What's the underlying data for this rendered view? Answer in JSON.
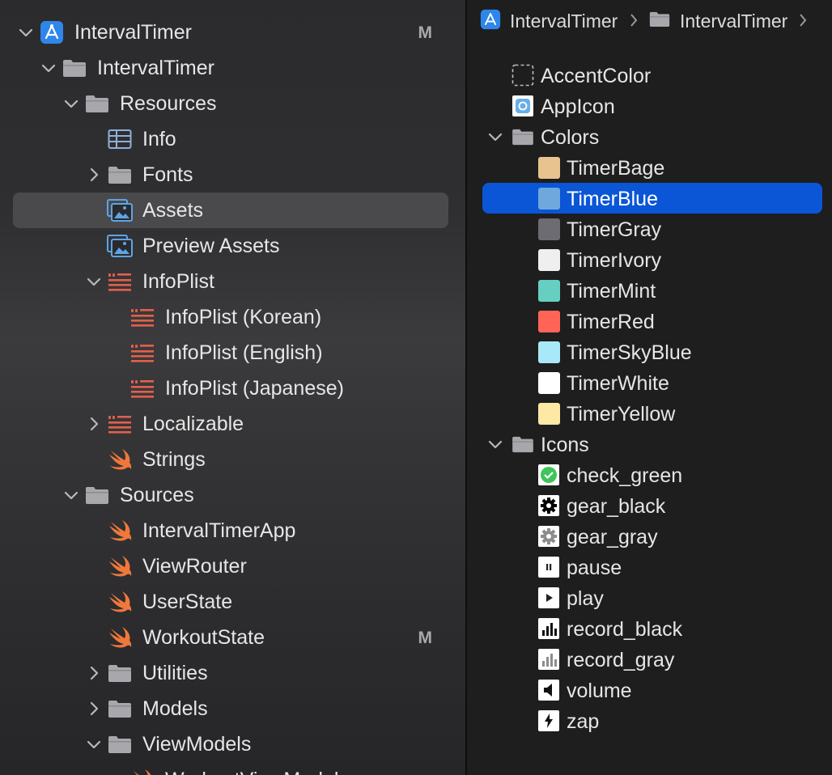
{
  "navigator": {
    "rows": [
      {
        "label": "IntervalTimer",
        "icon": "xcode-project-icon",
        "badge": "M",
        "chevron": "down"
      },
      {
        "label": "IntervalTimer",
        "icon": "folder-icon",
        "chevron": "down"
      },
      {
        "label": "Resources",
        "icon": "folder-icon",
        "chevron": "down"
      },
      {
        "label": "Info",
        "icon": "table-icon"
      },
      {
        "label": "Fonts",
        "icon": "folder-icon",
        "chevron": "right"
      },
      {
        "label": "Assets",
        "icon": "asset-catalog-icon",
        "selected": true
      },
      {
        "label": "Preview Assets",
        "icon": "asset-catalog-icon"
      },
      {
        "label": "InfoPlist",
        "icon": "strings-icon",
        "chevron": "down"
      },
      {
        "label": "InfoPlist (Korean)",
        "icon": "strings-icon"
      },
      {
        "label": "InfoPlist (English)",
        "icon": "strings-icon"
      },
      {
        "label": "InfoPlist (Japanese)",
        "icon": "strings-icon"
      },
      {
        "label": "Localizable",
        "icon": "strings-icon",
        "chevron": "right"
      },
      {
        "label": "Strings",
        "icon": "swift-icon"
      },
      {
        "label": "Sources",
        "icon": "folder-icon",
        "chevron": "down"
      },
      {
        "label": "IntervalTimerApp",
        "icon": "swift-icon"
      },
      {
        "label": "ViewRouter",
        "icon": "swift-icon"
      },
      {
        "label": "UserState",
        "icon": "swift-icon"
      },
      {
        "label": "WorkoutState",
        "icon": "swift-icon",
        "badge": "M"
      },
      {
        "label": "Utilities",
        "icon": "folder-icon",
        "chevron": "right"
      },
      {
        "label": "Models",
        "icon": "folder-icon",
        "chevron": "right"
      },
      {
        "label": "ViewModels",
        "icon": "folder-icon",
        "chevron": "down"
      },
      {
        "label": "WorkoutViewModel",
        "icon": "swift-icon"
      }
    ]
  },
  "jump_bar": {
    "items": [
      "IntervalTimer",
      "IntervalTimer"
    ]
  },
  "assets": {
    "rows": [
      {
        "label": "AccentColor",
        "icon": "accent-color-icon"
      },
      {
        "label": "AppIcon",
        "icon": "app-icon-icon"
      },
      {
        "label": "Colors",
        "icon": "folder-icon",
        "chevron": "down"
      },
      {
        "label": "TimerBage",
        "icon": "color-swatch",
        "color": "#e8c38f"
      },
      {
        "label": "TimerBlue",
        "icon": "color-swatch",
        "color": "#6fa8dc",
        "selected": true
      },
      {
        "label": "TimerGray",
        "icon": "color-swatch",
        "color": "#6d6c73"
      },
      {
        "label": "TimerIvory",
        "icon": "color-swatch",
        "color": "#efefef"
      },
      {
        "label": "TimerMint",
        "icon": "color-swatch",
        "color": "#66cfc2"
      },
      {
        "label": "TimerRed",
        "icon": "color-swatch",
        "color": "#ff6457"
      },
      {
        "label": "TimerSkyBlue",
        "icon": "color-swatch",
        "color": "#a8e8f8"
      },
      {
        "label": "TimerWhite",
        "icon": "color-swatch",
        "color": "#ffffff"
      },
      {
        "label": "TimerYellow",
        "icon": "color-swatch",
        "color": "#fde9a4"
      },
      {
        "label": "Icons",
        "icon": "folder-icon",
        "chevron": "down"
      },
      {
        "label": "check_green",
        "icon": "check-green-icon"
      },
      {
        "label": "gear_black",
        "icon": "gear-black-icon"
      },
      {
        "label": "gear_gray",
        "icon": "gear-gray-icon"
      },
      {
        "label": "pause",
        "icon": "pause-icon"
      },
      {
        "label": "play",
        "icon": "play-icon"
      },
      {
        "label": "record_black",
        "icon": "record-black-icon"
      },
      {
        "label": "record_gray",
        "icon": "record-gray-icon"
      },
      {
        "label": "volume",
        "icon": "volume-icon"
      },
      {
        "label": "zap",
        "icon": "zap-icon"
      }
    ]
  },
  "colors": {
    "accent": "#0a56d6",
    "swift": "#f0783c",
    "strings": "#e2604c",
    "folder": "#a8a8ac",
    "project": "#2f86ea"
  }
}
